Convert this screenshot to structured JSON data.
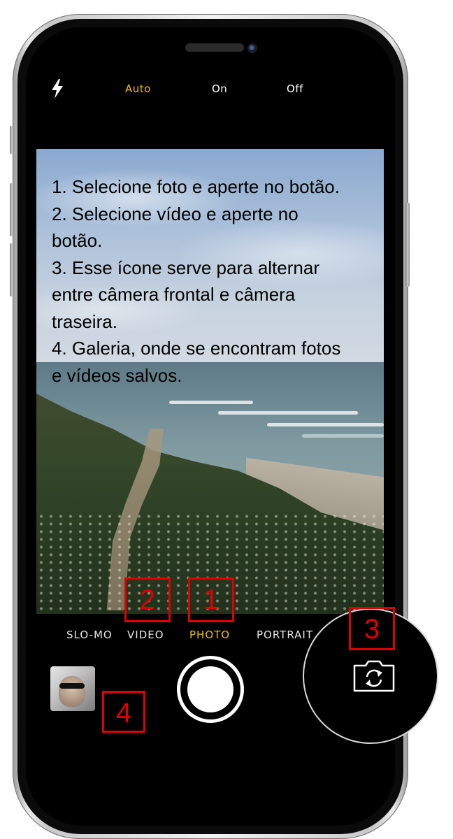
{
  "flash": {
    "icon": "flash-icon",
    "options": [
      {
        "label": "Auto",
        "active": true
      },
      {
        "label": "On",
        "active": false
      },
      {
        "label": "Off",
        "active": false
      }
    ],
    "active_color": "#f2c200"
  },
  "instructions": [
    "1. Selecione foto e aperte no botão.",
    "2. Selecione vídeo e aperte no\nbotão.",
    "3. Esse ícone serve para alternar\nentre câmera frontal e câmera\ntraseira.",
    "4. Galeria, onde se encontram fotos\ne vídeos salvos."
  ],
  "modes": [
    {
      "label": "SLO-MO",
      "active": false
    },
    {
      "label": "VIDEO",
      "active": false
    },
    {
      "label": "PHOTO",
      "active": true
    },
    {
      "label": "PORTRAIT",
      "active": false
    }
  ],
  "controls": {
    "gallery_icon": "gallery-thumbnail",
    "shutter_icon": "shutter-button",
    "flip_icon": "camera-flip-icon"
  },
  "annotations": [
    "2",
    "1",
    "3",
    "4"
  ],
  "annotation_color": "#e00000"
}
